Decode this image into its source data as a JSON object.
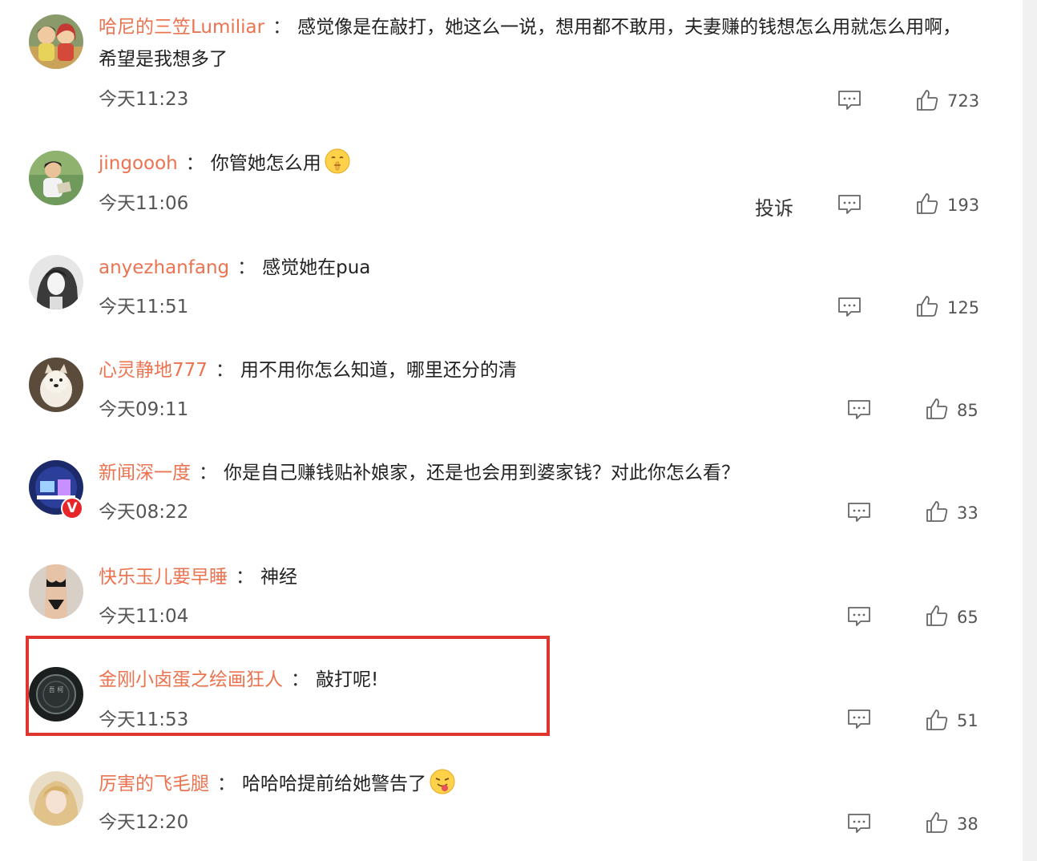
{
  "comments": [
    {
      "username": "哈尼的三笠Lumiliar",
      "separator": "：",
      "text": "感觉像是在敲打，她这么一说，想用都不敢用，夫妻赚的钱想怎么用就怎么用啊，希望是我想多了",
      "time": "今天11:23",
      "likes": "723",
      "avatar": "avatar-couple-cartoon"
    },
    {
      "username": "jingoooh",
      "separator": "：",
      "text": "你管她怎么用",
      "emoji": "shush-face-emoji",
      "time": "今天11:06",
      "complain": "投诉",
      "likes": "193",
      "avatar": "avatar-boy-reading"
    },
    {
      "username": "anyezhanfang",
      "separator": "：",
      "text": "感觉她在pua",
      "time": "今天11:51",
      "likes": "125",
      "avatar": "avatar-girl-bw"
    },
    {
      "username": "心灵静地777",
      "separator": "：",
      "text": "用不用你怎么知道，哪里还分的清",
      "time": "今天09:11",
      "likes": "85",
      "avatar": "avatar-dog"
    },
    {
      "username": "新闻深一度",
      "separator": "：",
      "text": "你是自己赚钱贴补娘家，还是也会用到婆家钱？对此你怎么看？",
      "time": "今天08:22",
      "likes": "33",
      "verified": "V",
      "avatar": "avatar-news-logo"
    },
    {
      "username": "快乐玉儿要早睡",
      "separator": "：",
      "text": "神经",
      "time": "今天11:04",
      "likes": "65",
      "avatar": "avatar-figure"
    },
    {
      "username": "金刚小卤蛋之绘画狂人",
      "separator": "：",
      "text": "敲打呢!",
      "time": "今天11:53",
      "likes": "51",
      "avatar": "avatar-dark-badge",
      "avatar_text": "吾 柯"
    },
    {
      "username": "厉害的飞毛腿",
      "separator": "：",
      "text": "哈哈哈提前给她警告了",
      "emoji": "tongue-face-emoji",
      "time": "今天12:20",
      "likes": "38",
      "avatar": "avatar-blonde-girl"
    }
  ],
  "colors": {
    "username": "#eb7350",
    "highlight_border": "#e0342f",
    "verified_badge": "#e8262a"
  }
}
